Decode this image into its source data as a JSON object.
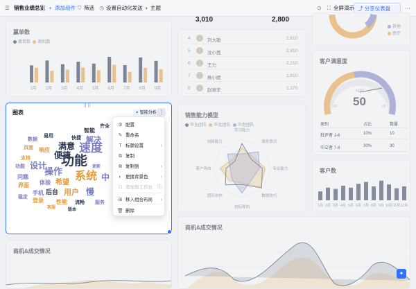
{
  "toolbar": {
    "title": "销售业绩总览",
    "add_component": "添加组件",
    "filter": "筛选",
    "auto_send": "设置自动化发送",
    "theme": "主题",
    "fullscreen": "全屏演示",
    "share": "分享仪表盘",
    "more": "···"
  },
  "kpi": {
    "left_value": "3,010",
    "right_value": "2,800"
  },
  "orders_card": {
    "title": "赢单数",
    "legend": [
      "赢单数",
      "商机数"
    ],
    "colors": {
      "won": "#1f2d4a",
      "opportunity": "#e39a3c"
    },
    "chart_data": {
      "type": "bar",
      "categories": [
        "1月",
        "2月",
        "3月",
        "4月",
        "5月",
        "6月",
        "7月",
        "8月",
        "9月"
      ],
      "series": [
        {
          "name": "赢单数",
          "values": [
            56,
            72,
            60,
            68,
            62,
            84,
            57,
            82,
            71
          ]
        },
        {
          "name": "商机数",
          "values": [
            48,
            38,
            42,
            49,
            40,
            58,
            35,
            48,
            44
          ]
        }
      ],
      "ylim": [
        0,
        100
      ]
    }
  },
  "ranking": {
    "rows": [
      {
        "rank": "4",
        "name": "刘大雄",
        "value": "2,610"
      },
      {
        "rank": "5",
        "name": "沈小茜",
        "value": "2,810"
      },
      {
        "rank": "6",
        "name": "王力",
        "value": "2,210"
      },
      {
        "rank": "7",
        "name": "杨小妮",
        "value": "1,810"
      },
      {
        "rank": "8",
        "name": "赵顺丰",
        "value": "1,270"
      }
    ]
  },
  "top_right": {
    "legend": [
      "其他",
      "医疗"
    ]
  },
  "satisfaction": {
    "title": "客户满意度",
    "gauge": {
      "label": "NPS",
      "value": "50",
      "min_label": "-100",
      "max_label": "100",
      "left_tick": "-50",
      "right_tick": "50"
    },
    "headers": [
      "类别",
      "占比",
      "数量"
    ],
    "rows": [
      {
        "cat": "批评者 1-6",
        "pct": "10%",
        "qty": "10"
      },
      {
        "cat": "中立者 7-8",
        "pct": "30%",
        "qty": "30"
      }
    ]
  },
  "chart_card": {
    "title": "图表",
    "drag_dots": "⠿⠿",
    "ai_button": "智能分析",
    "more": "⋮",
    "words": [
      {
        "t": "功能",
        "s": 19,
        "c": "#2f3a52",
        "x": 88,
        "y": 242
      },
      {
        "t": "速度",
        "s": 17,
        "c": "#7b7fc2",
        "x": 114,
        "y": 222
      },
      {
        "t": "系统",
        "s": 16,
        "c": "#e39a3c",
        "x": 108,
        "y": 263
      },
      {
        "t": "操作",
        "s": 13,
        "c": "#7b7fc2",
        "x": 64,
        "y": 254
      },
      {
        "t": "满意",
        "s": 12,
        "c": "#2f3a52",
        "x": 84,
        "y": 217
      },
      {
        "t": "便捷",
        "s": 12,
        "c": "#2f3a52",
        "x": 78,
        "y": 230
      },
      {
        "t": "设计",
        "s": 12,
        "c": "#7b7fc2",
        "x": 43,
        "y": 245
      },
      {
        "t": "解决",
        "s": 11,
        "c": "#7b7fc2",
        "x": 124,
        "y": 208
      },
      {
        "t": "用户",
        "s": 11,
        "c": "#e39a3c",
        "x": 92,
        "y": 284
      },
      {
        "t": "希望",
        "s": 10,
        "c": "#e39a3c",
        "x": 80,
        "y": 269
      },
      {
        "t": "慢",
        "s": 12,
        "c": "#7b7fc2",
        "x": 124,
        "y": 283
      },
      {
        "t": "中",
        "s": 12,
        "c": "#7b7fc2",
        "x": 146,
        "y": 262
      },
      {
        "t": "后台",
        "s": 9,
        "c": "#2f3a52",
        "x": 66,
        "y": 282
      },
      {
        "t": "智能",
        "s": 8,
        "c": "#2f3a52",
        "x": 121,
        "y": 193
      },
      {
        "t": "响应",
        "s": 8,
        "c": "#e39a3c",
        "x": 56,
        "y": 221
      },
      {
        "t": "体验",
        "s": 8,
        "c": "#7b7fc2",
        "x": 57,
        "y": 268
      },
      {
        "t": "问题",
        "s": 8,
        "c": "#7b7fc2",
        "x": 25,
        "y": 260
      },
      {
        "t": "界面",
        "s": 8,
        "c": "#e39a3c",
        "x": 26,
        "y": 272
      },
      {
        "t": "手机",
        "s": 8,
        "c": "#7b7fc2",
        "x": 47,
        "y": 283
      },
      {
        "t": "登录",
        "s": 8,
        "c": "#e39a3c",
        "x": 47,
        "y": 294
      },
      {
        "t": "性能",
        "s": 8,
        "c": "#e39a3c",
        "x": 81,
        "y": 296
      },
      {
        "t": "数据",
        "s": 7,
        "c": "#7b7fc2",
        "x": 40,
        "y": 205
      },
      {
        "t": "支持",
        "s": 7,
        "c": "#e39a3c",
        "x": 30,
        "y": 232
      },
      {
        "t": "流畅",
        "s": 7,
        "c": "#2f3a52",
        "x": 108,
        "y": 296
      },
      {
        "t": "服务",
        "s": 7,
        "c": "#7b7fc2",
        "x": 137,
        "y": 296
      },
      {
        "t": "齐全",
        "s": 7,
        "c": "#2f3a52",
        "x": 144,
        "y": 186
      },
      {
        "t": "稳定",
        "s": 7,
        "c": "#7b7fc2",
        "x": 26,
        "y": 288
      },
      {
        "t": "易用",
        "s": 7,
        "c": "#2f3a52",
        "x": 63,
        "y": 200
      },
      {
        "t": "页面",
        "s": 7,
        "c": "#e39a3c",
        "x": 34,
        "y": 217
      },
      {
        "t": "功能",
        "s": 7,
        "c": "#7b7fc2",
        "x": 22,
        "y": 244
      },
      {
        "t": "快捷",
        "s": 7,
        "c": "#2f3a52",
        "x": 103,
        "y": 203
      },
      {
        "t": "客服",
        "s": 6,
        "c": "#e39a3c",
        "x": 68,
        "y": 303
      },
      {
        "t": "更新",
        "s": 6,
        "c": "#7b7fc2",
        "x": 133,
        "y": 244
      },
      {
        "t": "版本",
        "s": 6,
        "c": "#2f3a52",
        "x": 98,
        "y": 306
      }
    ]
  },
  "menu": {
    "items": [
      {
        "label": "配置",
        "icon": "gear-icon",
        "glyph": "⚙",
        "arrow": "",
        "disabled": false
      },
      {
        "label": "重命名",
        "icon": "edit-icon",
        "glyph": "✎",
        "arrow": "",
        "disabled": false
      },
      {
        "label": "标题设置",
        "icon": "title-icon",
        "glyph": "T",
        "arrow": "›",
        "disabled": false
      },
      {
        "label": "复制",
        "icon": "copy-icon",
        "glyph": "⧉",
        "arrow": "",
        "disabled": false
      },
      {
        "label": "复制到",
        "icon": "copy-to-icon",
        "glyph": "⧉",
        "arrow": "›",
        "disabled": false
      },
      {
        "label": "更换背景色",
        "icon": "palette-icon",
        "glyph": "◐",
        "arrow": "›",
        "disabled": false
      },
      {
        "label": "添加到工作台",
        "icon": "workspace-icon",
        "glyph": "⊡",
        "arrow": "ⓘ",
        "disabled": true
      },
      {
        "label": "移入组合布局",
        "icon": "layout-icon",
        "glyph": "⊞",
        "arrow": "›",
        "disabled": false
      },
      {
        "label": "删除",
        "icon": "trash-icon",
        "glyph": "🗑",
        "arrow": "",
        "disabled": false
      }
    ]
  },
  "radar": {
    "title": "销售能力模型",
    "legend": [
      "华东团队",
      "华北团队",
      "华南团队"
    ],
    "axes": [
      "学习能力",
      "服务意识",
      "专业能力",
      "数据技巧",
      "目标导向",
      "团队协作",
      "客户导向",
      "创新能力"
    ]
  },
  "customers": {
    "title": "客户数",
    "chart_data": {
      "type": "bar",
      "categories": [
        "1月",
        "2月",
        "3月",
        "4月",
        "5月",
        "6月",
        "7月",
        "8月",
        "9月",
        "10月",
        "11月",
        "12月"
      ],
      "values": [
        28,
        40,
        36,
        46,
        40,
        52,
        58,
        44,
        62,
        50,
        38,
        44
      ],
      "ylim": [
        0,
        70
      ]
    }
  },
  "bottom_left": {
    "title": "商机&成交情况"
  },
  "bottom_mid": {
    "title": "商机&成交情况"
  },
  "fab": "✦"
}
